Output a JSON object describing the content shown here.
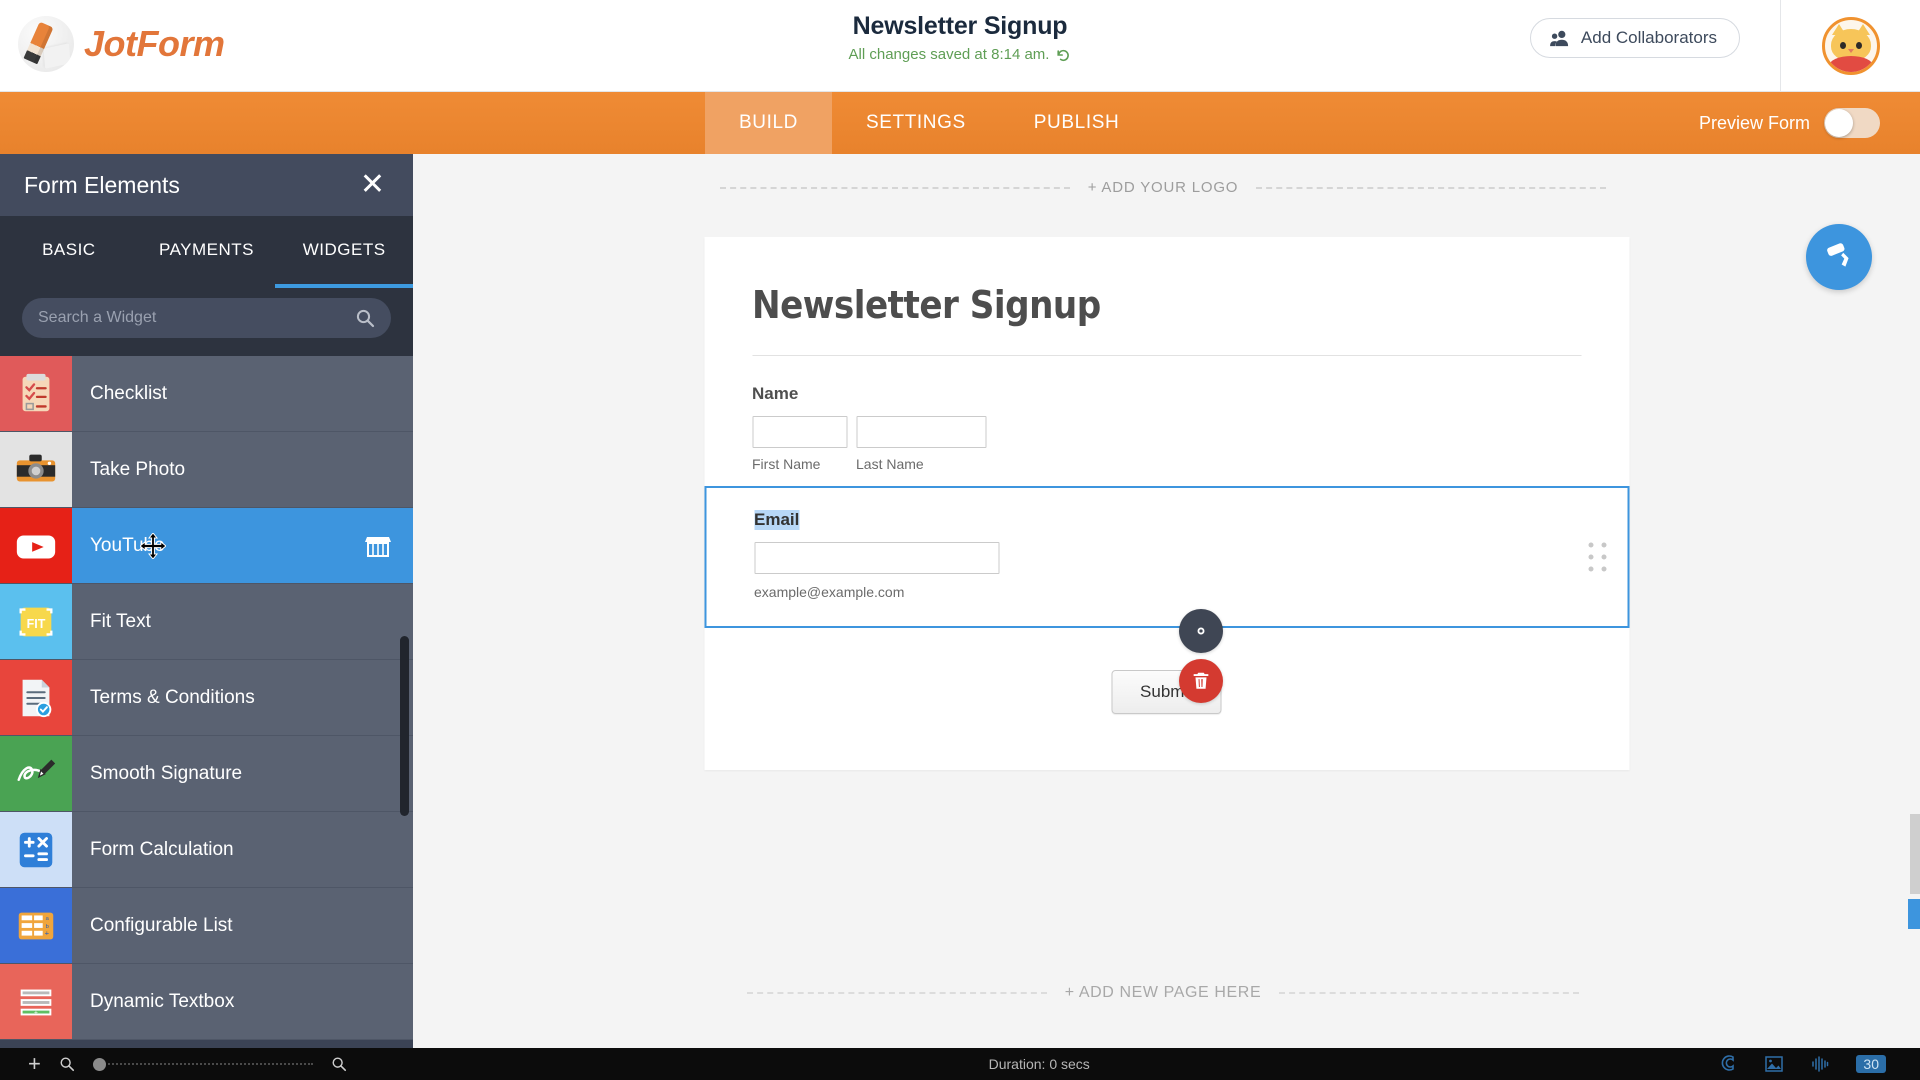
{
  "header": {
    "brand": "JotForm",
    "brand_icon": "pencil-logo-icon",
    "form_title": "Newsletter Signup",
    "save_status": "All changes saved at 8:14 am.",
    "undo_icon": "undo-arrow-icon",
    "collaborators_label": "Add Collaborators",
    "collaborators_icon": "people-icon",
    "avatar_icon": "cat-avatar",
    "accent_color": "#e2763a",
    "save_color": "#5f9e55"
  },
  "nav": {
    "tabs": [
      {
        "label": "BUILD",
        "active": true
      },
      {
        "label": "SETTINGS",
        "active": false
      },
      {
        "label": "PUBLISH",
        "active": false
      }
    ],
    "preview_label": "Preview Form",
    "preview_on": false,
    "bar_color": "#e8822c",
    "active_tab_color": "#f0a263"
  },
  "sidebar": {
    "title": "Form Elements",
    "close_icon": "close-icon",
    "tabs": [
      {
        "label": "BASIC",
        "active": false
      },
      {
        "label": "PAYMENTS",
        "active": false
      },
      {
        "label": "WIDGETS",
        "active": true
      }
    ],
    "active_underline_color": "#3d9ae0",
    "search": {
      "placeholder": "Search a Widget",
      "value": "",
      "icon": "search-icon"
    },
    "widgets": [
      {
        "name": "Checklist",
        "icon": "checklist-icon",
        "selected": false,
        "store": false
      },
      {
        "name": "Take Photo",
        "icon": "camera-icon",
        "selected": false,
        "store": false
      },
      {
        "name": "YouTube",
        "icon": "youtube-icon",
        "selected": true,
        "store": true
      },
      {
        "name": "Fit Text",
        "icon": "fit-text-icon",
        "selected": false,
        "store": false
      },
      {
        "name": "Terms & Conditions",
        "icon": "document-check-icon",
        "selected": false,
        "store": false
      },
      {
        "name": "Smooth Signature",
        "icon": "signature-pen-icon",
        "selected": false,
        "store": false
      },
      {
        "name": "Form Calculation",
        "icon": "calculator-icon",
        "selected": false,
        "store": false
      },
      {
        "name": "Configurable List",
        "icon": "list-grid-icon",
        "selected": false,
        "store": false
      },
      {
        "name": "Dynamic Textbox",
        "icon": "dynamic-textbox-icon",
        "selected": false,
        "store": false
      }
    ],
    "selected_color": "#3d95de",
    "panel_color": "#3b4355"
  },
  "canvas": {
    "logo_drop_label": "+ ADD YOUR LOGO",
    "add_page_label": "+ ADD NEW PAGE HERE",
    "form": {
      "heading": "Newsletter Signup",
      "fields": [
        {
          "label": "Name",
          "selected": false,
          "subfields": [
            {
              "sub_label": "First Name",
              "value": ""
            },
            {
              "sub_label": "Last Name",
              "value": ""
            }
          ]
        },
        {
          "label": "Email",
          "selected": true,
          "label_highlighted": true,
          "value": "",
          "hint": "example@example.com"
        }
      ],
      "submit_label": "Submit"
    },
    "field_actions": {
      "gear_icon": "gear-icon",
      "trash_icon": "trash-icon",
      "drag_handle_icon": "drag-dots-icon"
    },
    "paint_fab_icon": "paint-roller-icon",
    "selection_color": "#3d95de"
  },
  "statusbar": {
    "plus_icon": "plus-icon",
    "zoom_out_icon": "search-minus-icon",
    "zoom_in_icon": "search-plus-icon",
    "duration": "Duration: 0 secs",
    "right_icons": [
      "magnet-icon",
      "image-icon",
      "audio-wave-icon"
    ],
    "fps_badge": "30"
  }
}
